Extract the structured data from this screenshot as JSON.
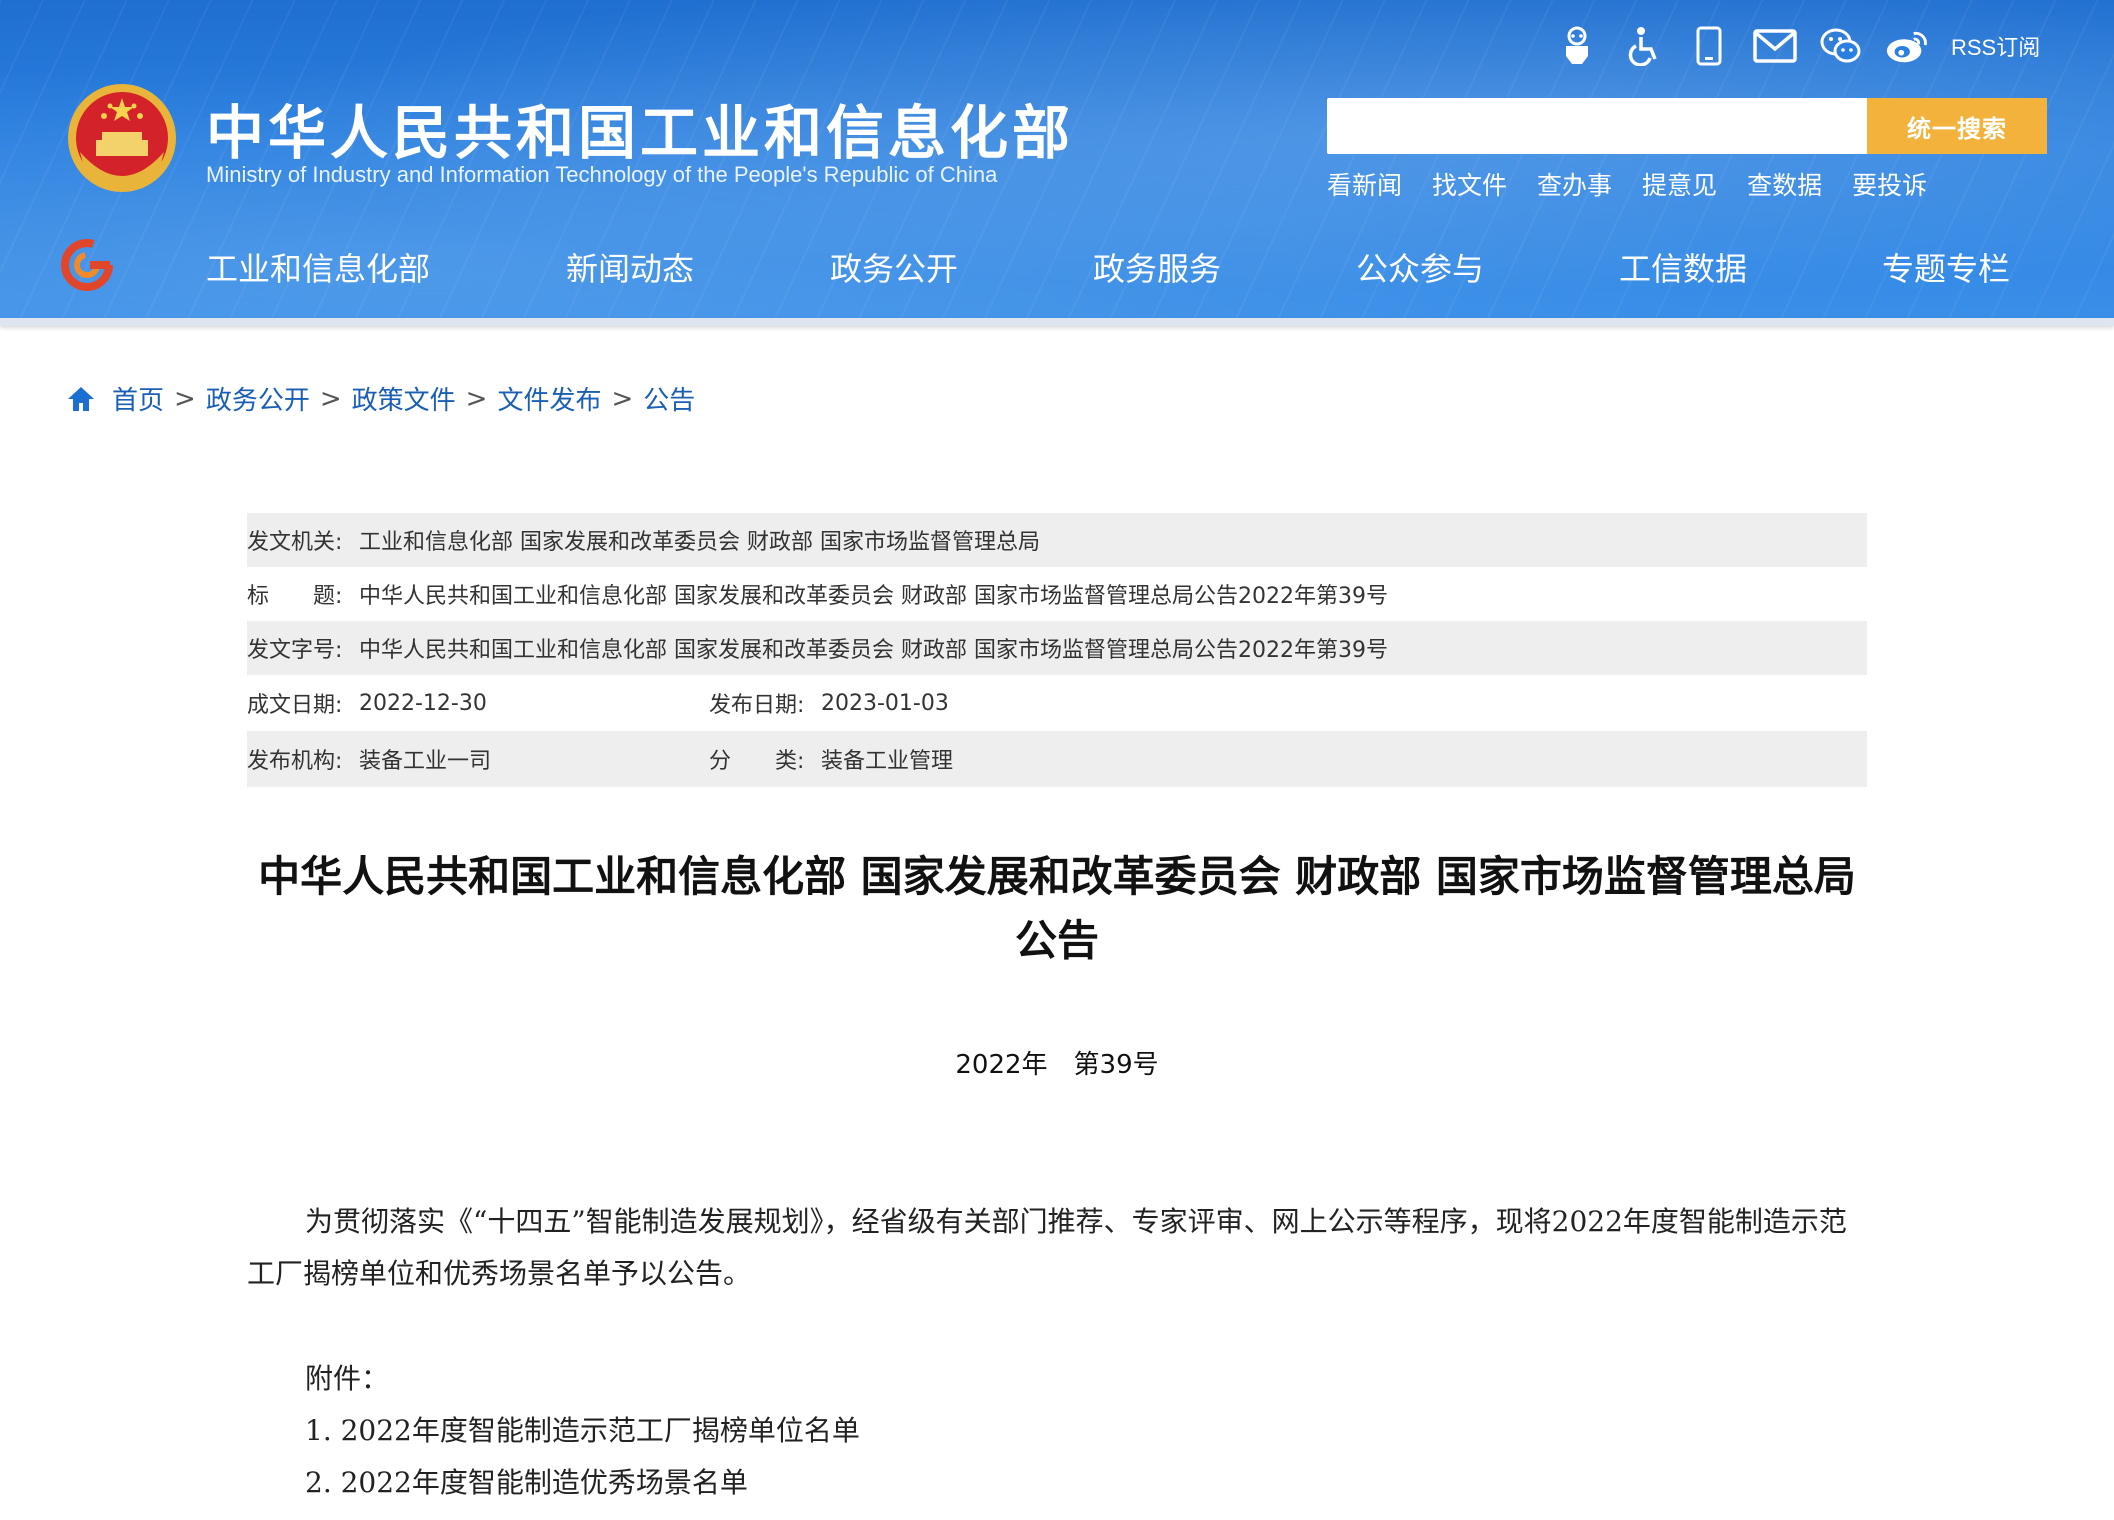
{
  "header": {
    "title": "中华人民共和国工业和信息化部",
    "subtitle": "Ministry of Industry and Information Technology of the People's Republic of China",
    "rss_label": "RSS订阅",
    "top_icons": [
      "robot-icon",
      "accessibility-icon",
      "mobile-icon",
      "mail-icon",
      "wechat-icon",
      "weibo-icon"
    ],
    "search": {
      "placeholder": "",
      "button_label": "统一搜索"
    },
    "quick_links": [
      "看新闻",
      "找文件",
      "查办事",
      "提意见",
      "查数据",
      "要投诉"
    ],
    "nav": [
      "工业和信息化部",
      "新闻动态",
      "政务公开",
      "政务服务",
      "公众参与",
      "工信数据",
      "专题专栏"
    ],
    "colors": {
      "header_blue": "#2a80e0",
      "search_button": "#f2b23c",
      "link_blue": "#1a5fb4"
    }
  },
  "breadcrumb": {
    "items": [
      "首页",
      "政务公开",
      "政策文件",
      "文件发布",
      "公告"
    ],
    "separator": ">"
  },
  "meta": {
    "issuer": {
      "label": "发文机关:",
      "value": "工业和信息化部 国家发展和改革委员会 财政部 国家市场监督管理总局"
    },
    "title": {
      "label": "标　　题:",
      "value": "中华人民共和国工业和信息化部 国家发展和改革委员会 财政部 国家市场监督管理总局公告2022年第39号"
    },
    "doc_no": {
      "label": "发文字号:",
      "value": "中华人民共和国工业和信息化部 国家发展和改革委员会 财政部 国家市场监督管理总局公告2022年第39号"
    },
    "created": {
      "label": "成文日期:",
      "value": "2022-12-30"
    },
    "published": {
      "label": "发布日期:",
      "value": "2023-01-03"
    },
    "publisher": {
      "label": "发布机构:",
      "value": "装备工业一司"
    },
    "category": {
      "label": "分　　类:",
      "value": "装备工业管理"
    }
  },
  "document": {
    "title": "中华人民共和国工业和信息化部 国家发展和改革委员会 财政部 国家市场监督管理总局公告",
    "number": "2022年　第39号",
    "body": "为贯彻落实《“十四五”智能制造发展规划》，经省级有关部门推荐、专家评审、网上公示等程序，现将2022年度智能制造示范工厂揭榜单位和优秀场景名单予以公告。",
    "attachments_label": "附件：",
    "attachments": [
      "1.  2022年度智能制造示范工厂揭榜单位名单",
      "2.  2022年度智能制造优秀场景名单"
    ]
  }
}
